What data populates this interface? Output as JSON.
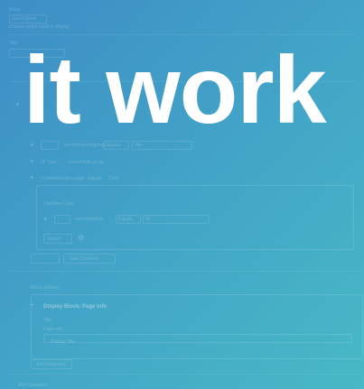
{
  "background": {
    "gradient_start": "#3d8ec6",
    "gradient_end": "#48b9c6"
  },
  "hero_text": "it work",
  "form": {
    "block_label": "Block",
    "block_select": "Select Block",
    "block_help": "Choose which block to display",
    "title_label": "Title",
    "rows": [
      {
        "field": "user/reference/group",
        "op": "Equals",
        "value": "Yes"
      },
      {
        "field": "IP Type",
        "op": "User/Admin group"
      },
      {
        "field": "Content/section page",
        "op": "Equals",
        "value": "Child"
      }
    ],
    "condition_type_label": "Condition Type",
    "condition_row": {
      "field": "user/reference",
      "op": "Equals",
      "value": "Or"
    },
    "and_label": "Select",
    "add_condition": "Add Condition",
    "action_label": "Block Options",
    "action_title": "Display Block: Page Info",
    "title_sub_label": "Title",
    "title_sub_value": "Page Info",
    "show_title": "Display Title",
    "add_response": "Add Response",
    "add_condition_bottom": "Add Condition"
  }
}
